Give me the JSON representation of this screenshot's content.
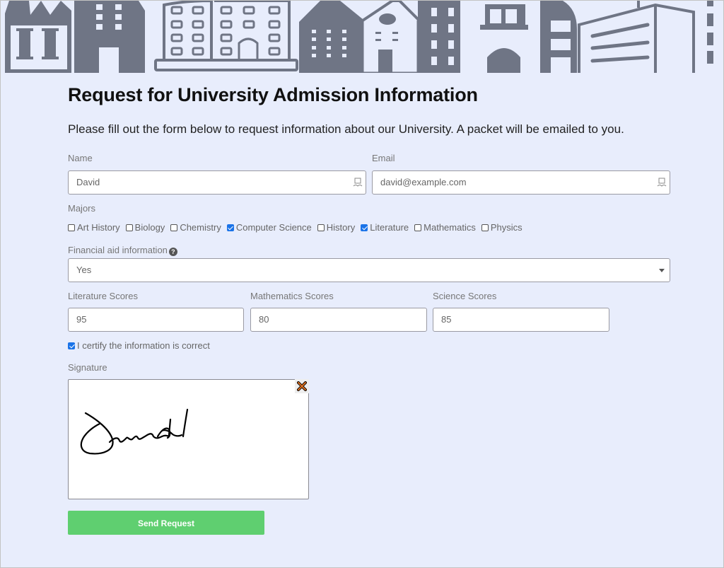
{
  "banner": {
    "description": "city-buildings-illustration",
    "color": "#6f7585"
  },
  "header": {
    "title": "Request for University Admission Information",
    "subtitle": "Please fill out the form below to request information about our University.  A packet will be emailed to you."
  },
  "fields": {
    "name": {
      "label": "Name",
      "value": "David"
    },
    "email": {
      "label": "Email",
      "value": "david@example.com"
    }
  },
  "majors": {
    "label": "Majors",
    "options": [
      {
        "label": "Art History",
        "checked": false
      },
      {
        "label": "Biology",
        "checked": false
      },
      {
        "label": "Chemistry",
        "checked": false
      },
      {
        "label": "Computer Science",
        "checked": true
      },
      {
        "label": "History",
        "checked": false
      },
      {
        "label": "Literature",
        "checked": true
      },
      {
        "label": "Mathematics",
        "checked": false
      },
      {
        "label": "Physics",
        "checked": false
      }
    ]
  },
  "financial_aid": {
    "label": "Financial aid information",
    "help_icon": "?",
    "value": "Yes"
  },
  "scores": {
    "literature": {
      "label": "Literature Scores",
      "value": "95"
    },
    "mathematics": {
      "label": "Mathematics Scores",
      "value": "80"
    },
    "science": {
      "label": "Science Scores",
      "value": "85"
    }
  },
  "certify": {
    "label": "I certify the information is correct",
    "checked": true
  },
  "signature": {
    "label": "Signature",
    "signed_name": "David",
    "clear_icon": "×"
  },
  "submit": {
    "label": "Send Request",
    "color": "#5fcf70"
  }
}
